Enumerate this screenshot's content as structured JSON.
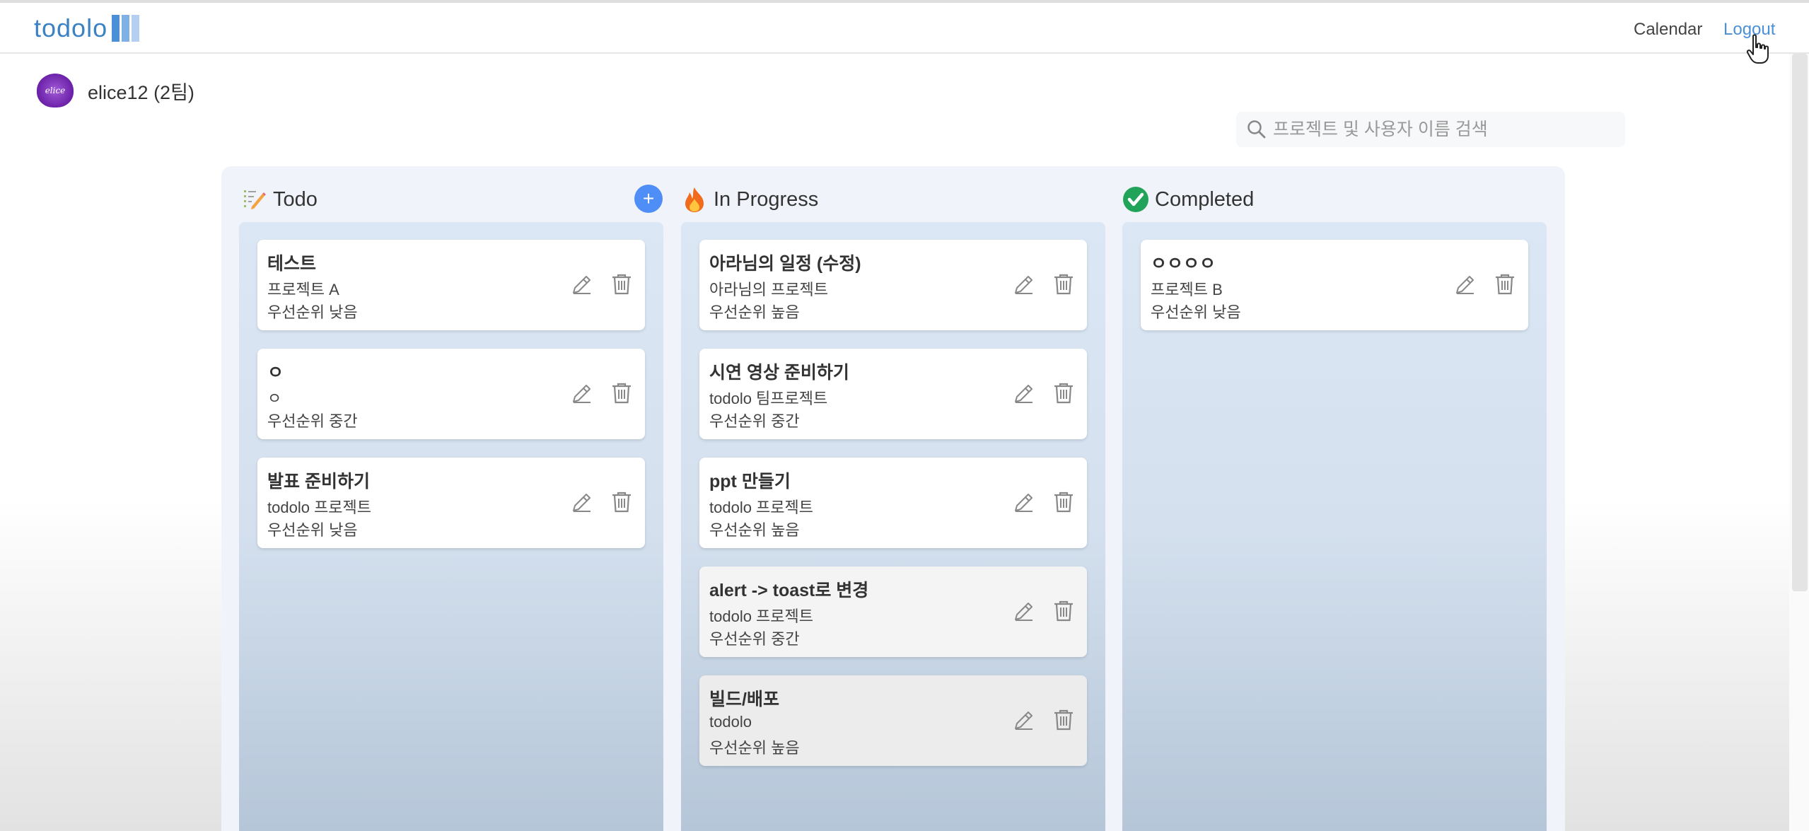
{
  "header": {
    "logo_text": "todolo",
    "nav": {
      "calendar": "Calendar",
      "logout": "Logout"
    }
  },
  "user": {
    "name": "elice12 (2팀)",
    "avatar_text": "elice"
  },
  "search": {
    "placeholder": "프로젝트 및 사용자 이름 검색"
  },
  "columns": [
    {
      "title": "Todo",
      "icon": "memo-icon",
      "cards": [
        {
          "title": "테스트",
          "project": "프로젝트 A",
          "priority": "우선순위 낮음"
        },
        {
          "title": "ㅇ",
          "project": "ㅇ",
          "priority": "우선순위 중간"
        },
        {
          "title": "발표 준비하기",
          "project": "todolo 프로젝트",
          "priority": "우선순위 낮음"
        }
      ]
    },
    {
      "title": "In Progress",
      "icon": "fire-icon",
      "cards": [
        {
          "title": "아라님의 일정 (수정)",
          "project": "아라님의 프로젝트",
          "priority": "우선순위 높음"
        },
        {
          "title": "시연 영상 준비하기",
          "project": "todolo 팀프로젝트",
          "priority": "우선순위 중간"
        },
        {
          "title": "ppt 만들기",
          "project": "todolo 프로젝트",
          "priority": "우선순위 높음"
        },
        {
          "title": "alert -> toast로 변경",
          "project": "todolo 프로젝트",
          "priority": "우선순위 중간"
        },
        {
          "title": "빌드/배포",
          "project": "todolo",
          "priority": "우선순위 높음"
        }
      ]
    },
    {
      "title": "Completed",
      "icon": "check-circle-icon",
      "cards": [
        {
          "title": "ㅇㅇㅇㅇ",
          "project": "프로젝트 B",
          "priority": "우선순위 낮음"
        }
      ]
    }
  ],
  "colors": {
    "brand": "#3b82c4",
    "logout_link": "#4a90d9",
    "add_button": "#4f8ef7",
    "lane_bg": "#dbe7f5",
    "completed_check": "#22a35a",
    "avatar": "#7e22ce"
  }
}
